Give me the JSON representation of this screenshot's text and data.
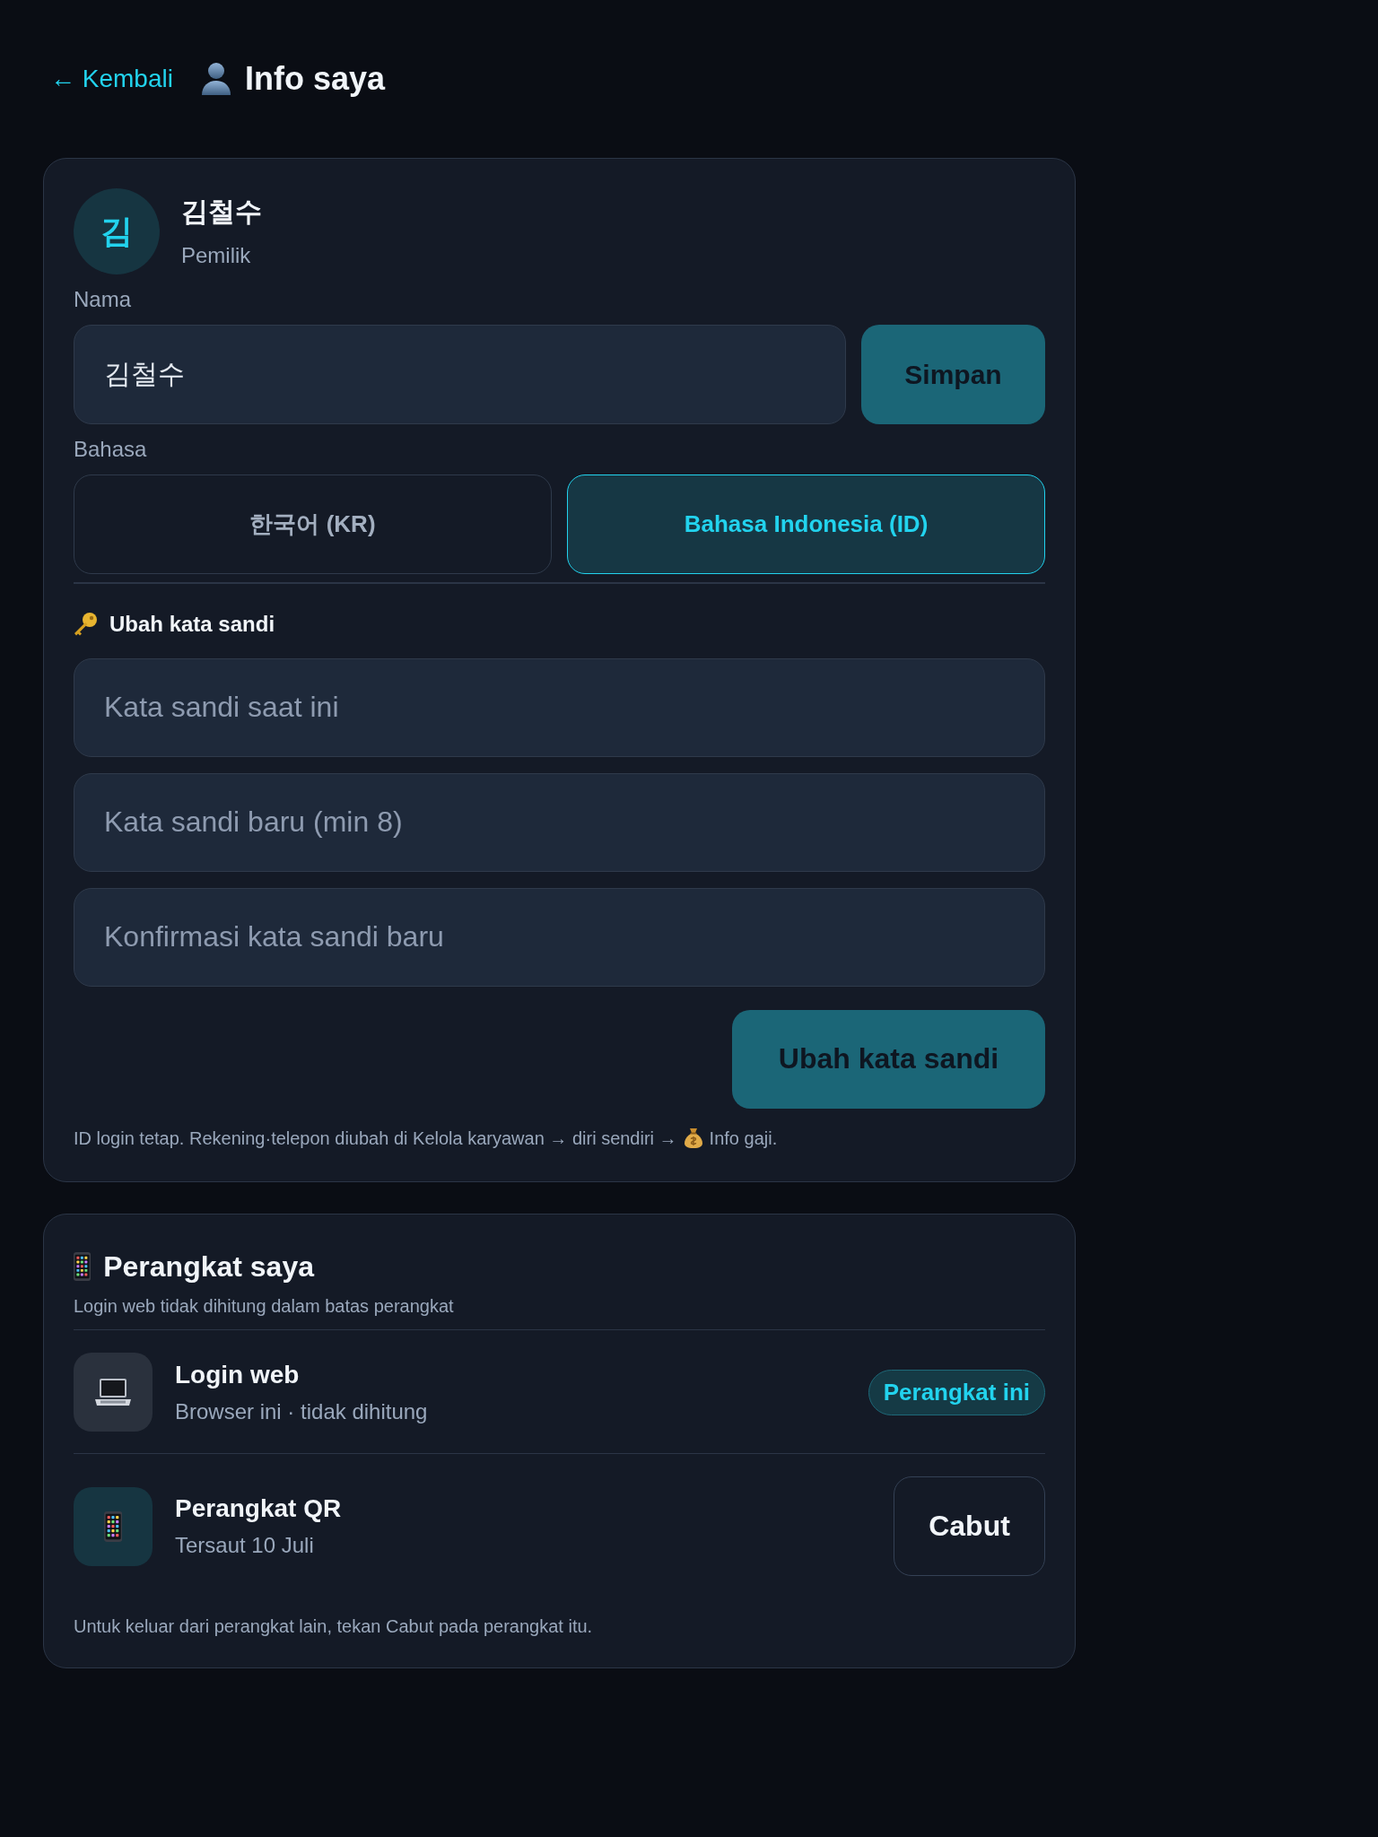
{
  "header": {
    "back_link": "← Kembali",
    "title": "Info saya"
  },
  "profile": {
    "initial": "김",
    "name": "김철수",
    "role": "Pemilik",
    "name_field": {
      "label": "Nama",
      "value": "김철수"
    },
    "save_button": "Simpan",
    "language": {
      "label": "Bahasa",
      "options": [
        {
          "label": "한국어 (KR)",
          "selected": false
        },
        {
          "label": "Bahasa Indonesia (ID)",
          "selected": true
        }
      ]
    },
    "password": {
      "heading": "Ubah kata sandi",
      "fields": [
        {
          "placeholder": "Kata sandi saat ini"
        },
        {
          "placeholder": "Kata sandi baru (min 8)"
        },
        {
          "placeholder": "Konfirmasi kata sandi baru"
        }
      ],
      "button": "Ubah kata sandi"
    },
    "note": {
      "before": "ID login tetap. Rekening·telepon diubah di Kelola karyawan → diri sendiri →",
      "after": "Info gaji."
    }
  },
  "devices": {
    "title": "Perangkat saya",
    "subtitle": "Login web tidak dihitung dalam batas perangkat",
    "items": [
      {
        "kind": "web",
        "name": "Login web",
        "detail": "Browser ini · tidak dihitung",
        "badge": "Perangkat ini"
      },
      {
        "kind": "qr",
        "name": "Perangkat QR",
        "detail": "Tersaut 10 Juli",
        "action": "Cabut"
      }
    ],
    "footnote": "Untuk keluar dari perangkat lain, tekan Cabut pada perangkat itu."
  }
}
